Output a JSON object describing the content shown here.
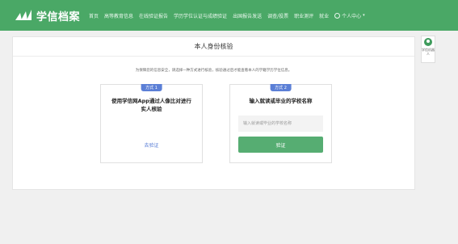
{
  "header": {
    "logo_text": "学信档案",
    "nav": [
      "首页",
      "高等教育信息",
      "在线验证报告",
      "学历学位认证与成绩验证",
      "出国报告发送",
      "调查/投票",
      "职业测评",
      "就业"
    ],
    "user_menu": "个人中心"
  },
  "side_widget": {
    "label": "学信机器人"
  },
  "main": {
    "title": "本人身份核验",
    "notice": "为保障您的信息安全，请选择一种方式进行核验，核验通过后才能查看本人的学籍学历学位信息。",
    "methods": [
      {
        "badge": "方式 1",
        "title": "使用学信网App通过人像比对进行实人核验",
        "link": "去验证"
      },
      {
        "badge": "方式 2",
        "title": "输入就读或毕业的学校名称",
        "placeholder": "输入就读或毕业的学校名称",
        "button": "验证"
      }
    ]
  },
  "colors": {
    "header_bg": "#4aa866",
    "button": "#56ad72",
    "badge": "#5b7fd6"
  }
}
